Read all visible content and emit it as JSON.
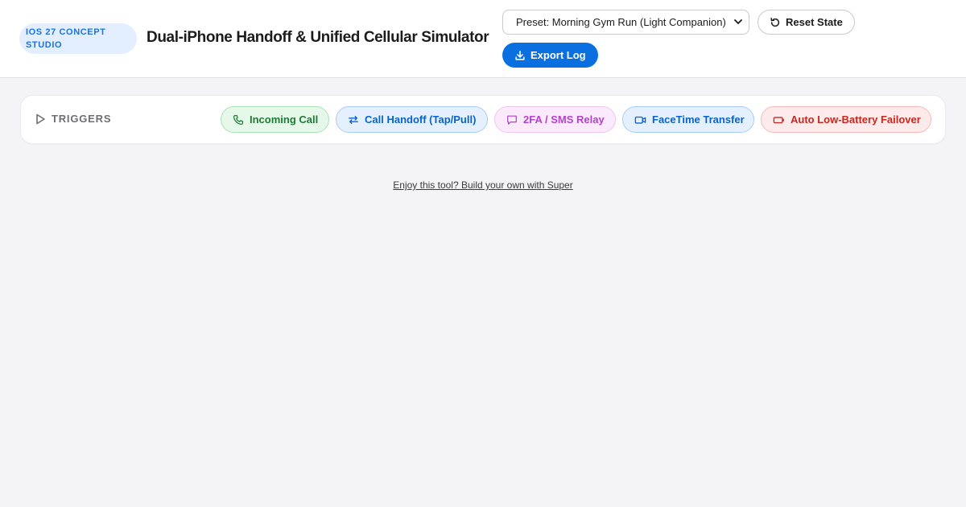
{
  "header": {
    "badge": "iOS 27 CONCEPT STUDIO",
    "title": "Dual-iPhone Handoff & Unified Cellular Simulator",
    "preset_select": {
      "selected": "Preset: Morning Gym Run (Light Companion)"
    },
    "reset_label": "Reset State",
    "export_label": "Export Log"
  },
  "triggers": {
    "label": "TRIGGERS",
    "items": [
      {
        "label": "Incoming Call",
        "icon": "phone-icon",
        "color": "#1f7a35"
      },
      {
        "label": "Call Handoff (Tap/Pull)",
        "icon": "swap-arrows-icon",
        "color": "#0a63c9"
      },
      {
        "label": "2FA / SMS Relay",
        "icon": "message-bubble-icon",
        "color": "#b044c7"
      },
      {
        "label": "FaceTime Transfer",
        "icon": "video-camera-icon",
        "color": "#0a63c9"
      },
      {
        "label": "Auto Low-Battery Failover",
        "icon": "battery-low-icon",
        "color": "#c8271f"
      }
    ]
  },
  "footer": {
    "link_text": "Enjoy this tool? Build your own with Super"
  },
  "colors": {
    "accent": "#0a6fdf",
    "background": "#f4f4f6"
  }
}
